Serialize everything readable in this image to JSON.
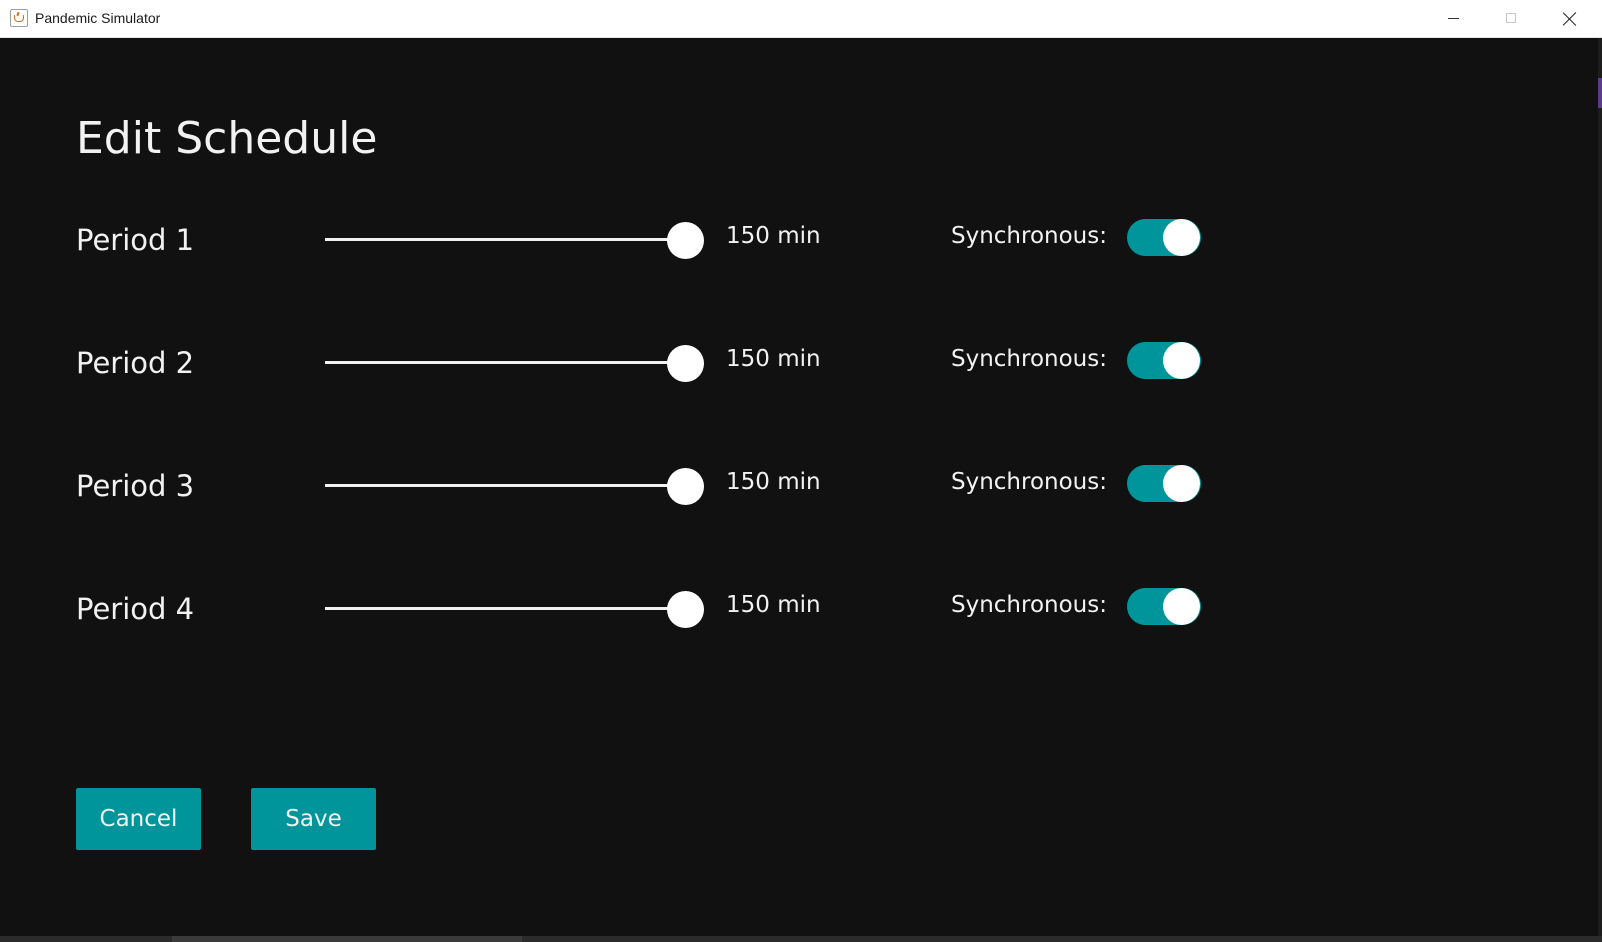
{
  "window": {
    "title": "Pandemic Simulator",
    "icon": "java-cup-icon"
  },
  "page": {
    "heading": "Edit Schedule"
  },
  "periods": [
    {
      "label": "Period 1",
      "value_text": "150 min",
      "slider_fraction": 1.0,
      "sync_label": "Synchronous:",
      "synchronous": true
    },
    {
      "label": "Period 2",
      "value_text": "150 min",
      "slider_fraction": 1.0,
      "sync_label": "Synchronous:",
      "synchronous": true
    },
    {
      "label": "Period 3",
      "value_text": "150 min",
      "slider_fraction": 1.0,
      "sync_label": "Synchronous:",
      "synchronous": true
    },
    {
      "label": "Period 4",
      "value_text": "150 min",
      "slider_fraction": 1.0,
      "sync_label": "Synchronous:",
      "synchronous": true
    }
  ],
  "actions": {
    "cancel_label": "Cancel",
    "save_label": "Save"
  },
  "colors": {
    "background": "#111111",
    "accent": "#00959a",
    "text": "#f2f2f2"
  }
}
